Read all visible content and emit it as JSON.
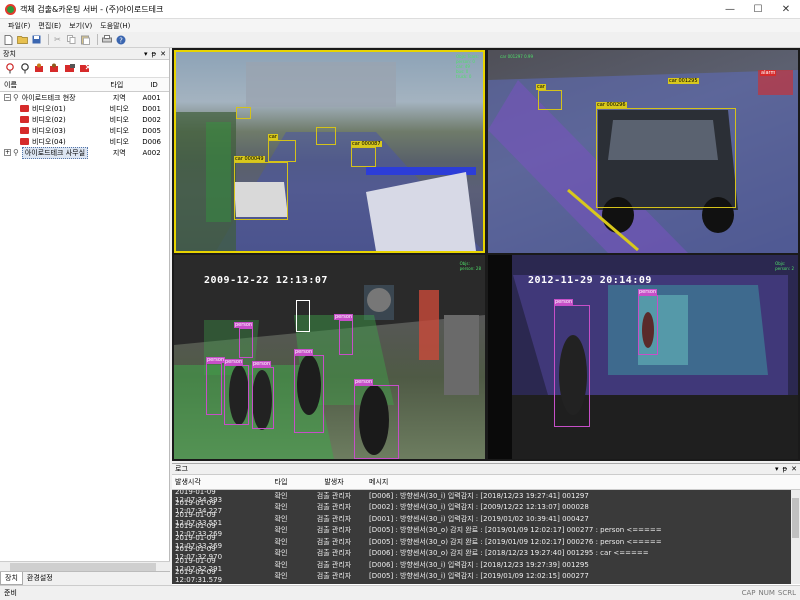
{
  "window": {
    "title": "객체 검출&카운팅 서버 - (주)아이로드테크",
    "minimize": "—",
    "maximize": "☐",
    "close": "✕"
  },
  "menu": [
    "파일(F)",
    "편집(E)",
    "보기(V)",
    "도움말(H)"
  ],
  "device_panel": {
    "title": "장치",
    "columns": {
      "name": "이름",
      "type": "타입",
      "id": "ID"
    },
    "rows": [
      {
        "name": "아이로드테크 현장",
        "type": "지역",
        "id": "A001",
        "kind": "site",
        "selected": false
      },
      {
        "name": "비디오(01)",
        "type": "비디오",
        "id": "D001",
        "kind": "camera"
      },
      {
        "name": "비디오(02)",
        "type": "비디오",
        "id": "D002",
        "kind": "camera"
      },
      {
        "name": "비디오(03)",
        "type": "비디오",
        "id": "D005",
        "kind": "camera"
      },
      {
        "name": "비디오(04)",
        "type": "비디오",
        "id": "D006",
        "kind": "camera"
      },
      {
        "name": "아이로드테크 사무실",
        "type": "지역",
        "id": "A002",
        "kind": "site",
        "selected": true
      }
    ],
    "tabs": [
      "장치",
      "환경설정"
    ]
  },
  "video": {
    "cam3_stamp": "2009-12-22 12:13:07",
    "cam4_stamp": "2012-11-29 20:14:09"
  },
  "log_panel": {
    "title": "로그",
    "columns": {
      "time": "발생시각",
      "type": "타입",
      "by": "발생자",
      "msg": "메시지"
    },
    "rows": [
      {
        "time": "2019-01-09 12:07:34.393",
        "type": "확인",
        "by": "검출 관리자",
        "msg": "[D006] : 방향센서(30_i) 입력감지 : [2018/12/23 19:27:41] 001297"
      },
      {
        "time": "2019-01-09 12:07:34.227",
        "type": "확인",
        "by": "검출 관리자",
        "msg": "[D002] : 방향센서(30_i) 입력감지 : [2009/12/22 12:13:07] 000028"
      },
      {
        "time": "2019-01-09 12:07:33.551",
        "type": "확인",
        "by": "검출 관리자",
        "msg": "[D001] : 방향센서(30_i) 입력감지 : [2019/01/02 10:39:41] 000427"
      },
      {
        "time": "2019-01-09 12:07:33.269",
        "type": "확인",
        "by": "검출 관리자",
        "msg": "[D005] : 방향센서(30_o) 감지 완료 : [2019/01/09 12:02:17] 000277 : person <====="
      },
      {
        "time": "2019-01-09 12:07:33.269",
        "type": "확인",
        "by": "검출 관리자",
        "msg": "[D005] : 방향센서(30_o) 감지 완료 : [2019/01/09 12:02:17] 000276 : person <====="
      },
      {
        "time": "2019-01-09 12:07:32.970",
        "type": "확인",
        "by": "검출 관리자",
        "msg": "[D006] : 방향센서(30_o) 감지 완료 : [2018/12/23 19:27:40] 001295 : car <====="
      },
      {
        "time": "2019-01-09 12:07:32.291",
        "type": "확인",
        "by": "검출 관리자",
        "msg": "[D006] : 방향센서(30_i) 입력감지 : [2018/12/23 19:27:39] 001295"
      },
      {
        "time": "2019-01-09 12:07:31.579",
        "type": "확인",
        "by": "검출 관리자",
        "msg": "[D005] : 방향센서(30_i) 입력감지 : [2019/01/09 12:02:15] 000277"
      }
    ]
  },
  "status": {
    "left": "준비",
    "keys": [
      "CAP",
      "NUM",
      "SCRL"
    ]
  },
  "colors": {
    "camera_icon": "#d62b2b",
    "box_yellow": "#d4c21a",
    "box_magenta": "#c64fc8",
    "selection": "#dde6f3",
    "log_bg": "#3a3a3a"
  }
}
